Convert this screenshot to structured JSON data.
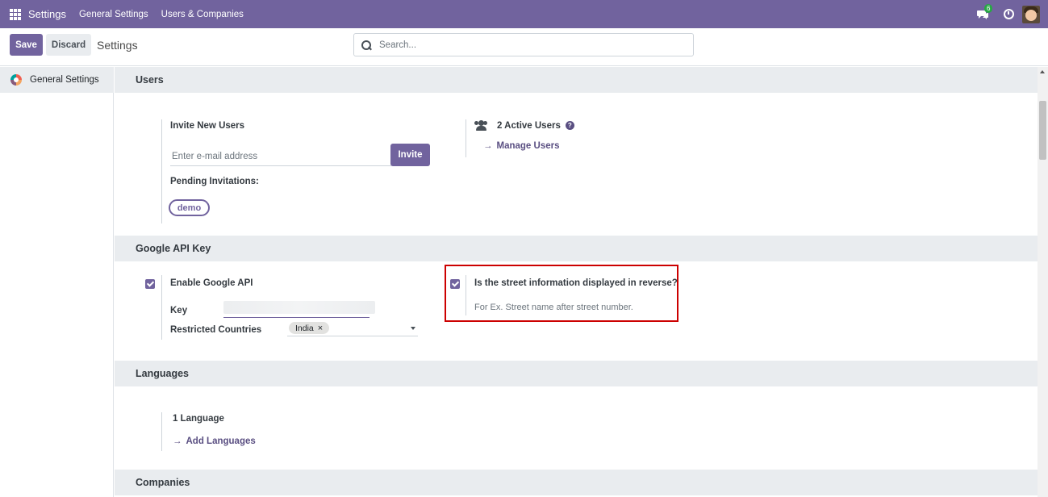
{
  "navbar": {
    "brand": "Settings",
    "menu": [
      "General Settings",
      "Users & Companies"
    ],
    "chat_badge": "6",
    "icons": [
      "apps-grid-icon",
      "chat-icon",
      "clock-icon",
      "avatar"
    ]
  },
  "control_panel": {
    "save_label": "Save",
    "discard_label": "Discard",
    "title": "Settings",
    "search_placeholder": "Search..."
  },
  "sidebar": {
    "items": [
      {
        "label": "General Settings",
        "active": true
      }
    ]
  },
  "sections": {
    "users": {
      "title": "Users",
      "invite_label": "Invite New Users",
      "email_placeholder": "Enter e-mail address",
      "invite_button": "Invite",
      "pending_label": "Pending Invitations:",
      "pending": [
        "demo"
      ],
      "active_users": "2 Active Users",
      "manage_users": "Manage Users"
    },
    "google_api": {
      "title": "Google API Key",
      "enable_label": "Enable Google API",
      "enable_checked": true,
      "key_label": "Key",
      "countries_label": "Restricted Countries",
      "countries": [
        "India"
      ],
      "reverse_label": "Is the street information displayed in reverse?",
      "reverse_checked": true,
      "reverse_help": "For Ex. Street name after street number."
    },
    "languages": {
      "title": "Languages",
      "count": "1 Language",
      "add_link": "Add Languages"
    },
    "companies": {
      "title": "Companies"
    }
  },
  "colors": {
    "primary": "#71639e",
    "highlight_border": "#cc0000",
    "section_bg": "#e9ecef"
  }
}
